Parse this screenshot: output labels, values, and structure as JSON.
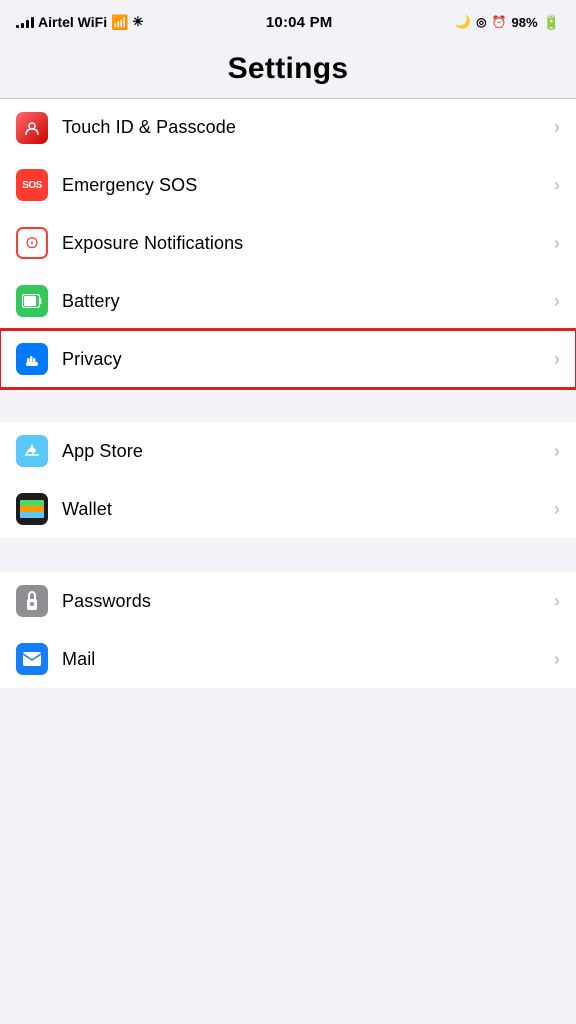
{
  "statusBar": {
    "carrier": "Airtel WiFi",
    "time": "10:04 PM",
    "battery": "98%",
    "icons": [
      "signal",
      "wifi",
      "sun"
    ]
  },
  "header": {
    "title": "Settings"
  },
  "sections": [
    {
      "id": "security",
      "rows": [
        {
          "id": "touch-id",
          "label": "Touch ID & Passcode",
          "iconType": "red-gradient",
          "iconText": ""
        },
        {
          "id": "emergency-sos",
          "label": "Emergency SOS",
          "iconType": "red",
          "iconText": "SOS"
        },
        {
          "id": "exposure",
          "label": "Exposure Notifications",
          "iconType": "dotted",
          "iconText": "⊙"
        },
        {
          "id": "battery",
          "label": "Battery",
          "iconType": "green",
          "iconText": "▋"
        },
        {
          "id": "privacy",
          "label": "Privacy",
          "iconType": "blue",
          "iconText": "✋",
          "highlighted": true
        }
      ]
    },
    {
      "id": "apps",
      "rows": [
        {
          "id": "app-store",
          "label": "App Store",
          "iconType": "sky",
          "iconText": "A"
        },
        {
          "id": "wallet",
          "label": "Wallet",
          "iconType": "dark",
          "iconText": "▤"
        }
      ]
    },
    {
      "id": "more-apps",
      "rows": [
        {
          "id": "passwords",
          "label": "Passwords",
          "iconType": "gray",
          "iconText": "🔑"
        },
        {
          "id": "mail",
          "label": "Mail",
          "iconType": "mail",
          "iconText": "✉"
        }
      ]
    }
  ]
}
